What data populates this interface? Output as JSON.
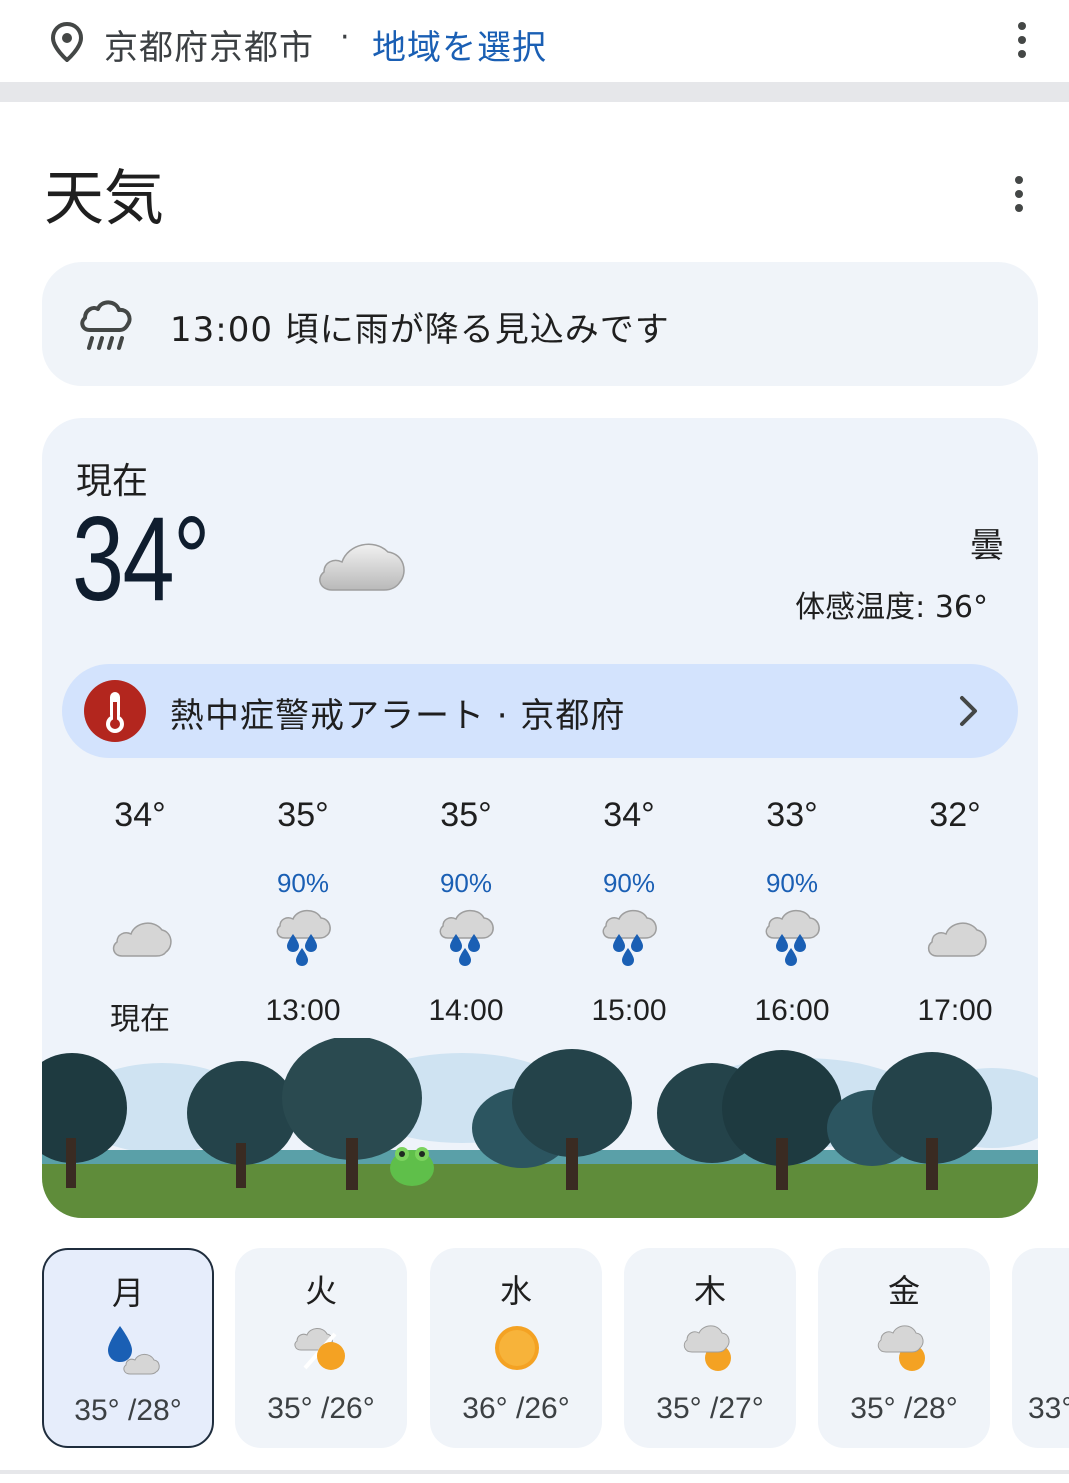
{
  "location": {
    "name": "京都府京都市",
    "separator": "·",
    "select_label": "地域を選択"
  },
  "section_title": "天気",
  "notice": {
    "icon": "rain-cloud-icon",
    "text": "13:00 頃に雨が降る見込みです"
  },
  "current": {
    "label": "現在",
    "temperature": "34°",
    "condition": "曇",
    "feels_like": "体感温度: 36°",
    "icon": "cloud-icon"
  },
  "alert": {
    "icon": "thermometer-icon",
    "text": "熱中症警戒アラート · 京都府"
  },
  "hourly": [
    {
      "temp": "34°",
      "prob": "",
      "icon": "cloud",
      "time": "現在"
    },
    {
      "temp": "35°",
      "prob": "90%",
      "icon": "rain",
      "time": "13:00"
    },
    {
      "temp": "35°",
      "prob": "90%",
      "icon": "rain",
      "time": "14:00"
    },
    {
      "temp": "34°",
      "prob": "90%",
      "icon": "rain",
      "time": "15:00"
    },
    {
      "temp": "33°",
      "prob": "90%",
      "icon": "rain",
      "time": "16:00"
    },
    {
      "temp": "32°",
      "prob": "",
      "icon": "cloud",
      "time": "17:00"
    }
  ],
  "daily": [
    {
      "day": "月",
      "icon": "rain-drop-cloud",
      "range": "35° /28°",
      "selected": true
    },
    {
      "day": "火",
      "icon": "cloud-sun-split",
      "range": "35° /26°",
      "selected": false
    },
    {
      "day": "水",
      "icon": "sun",
      "range": "36° /26°",
      "selected": false
    },
    {
      "day": "木",
      "icon": "cloud-sun",
      "range": "35° /27°",
      "selected": false
    },
    {
      "day": "金",
      "icon": "cloud-sun",
      "range": "35° /28°",
      "selected": false
    },
    {
      "day": "",
      "icon": "",
      "range": "33°",
      "selected": false
    }
  ],
  "colors": {
    "accent": "#1a5fb4",
    "alert_badge": "#b3261e",
    "alert_bg": "#d3e3fd",
    "card_bg": "#eef3fa"
  }
}
